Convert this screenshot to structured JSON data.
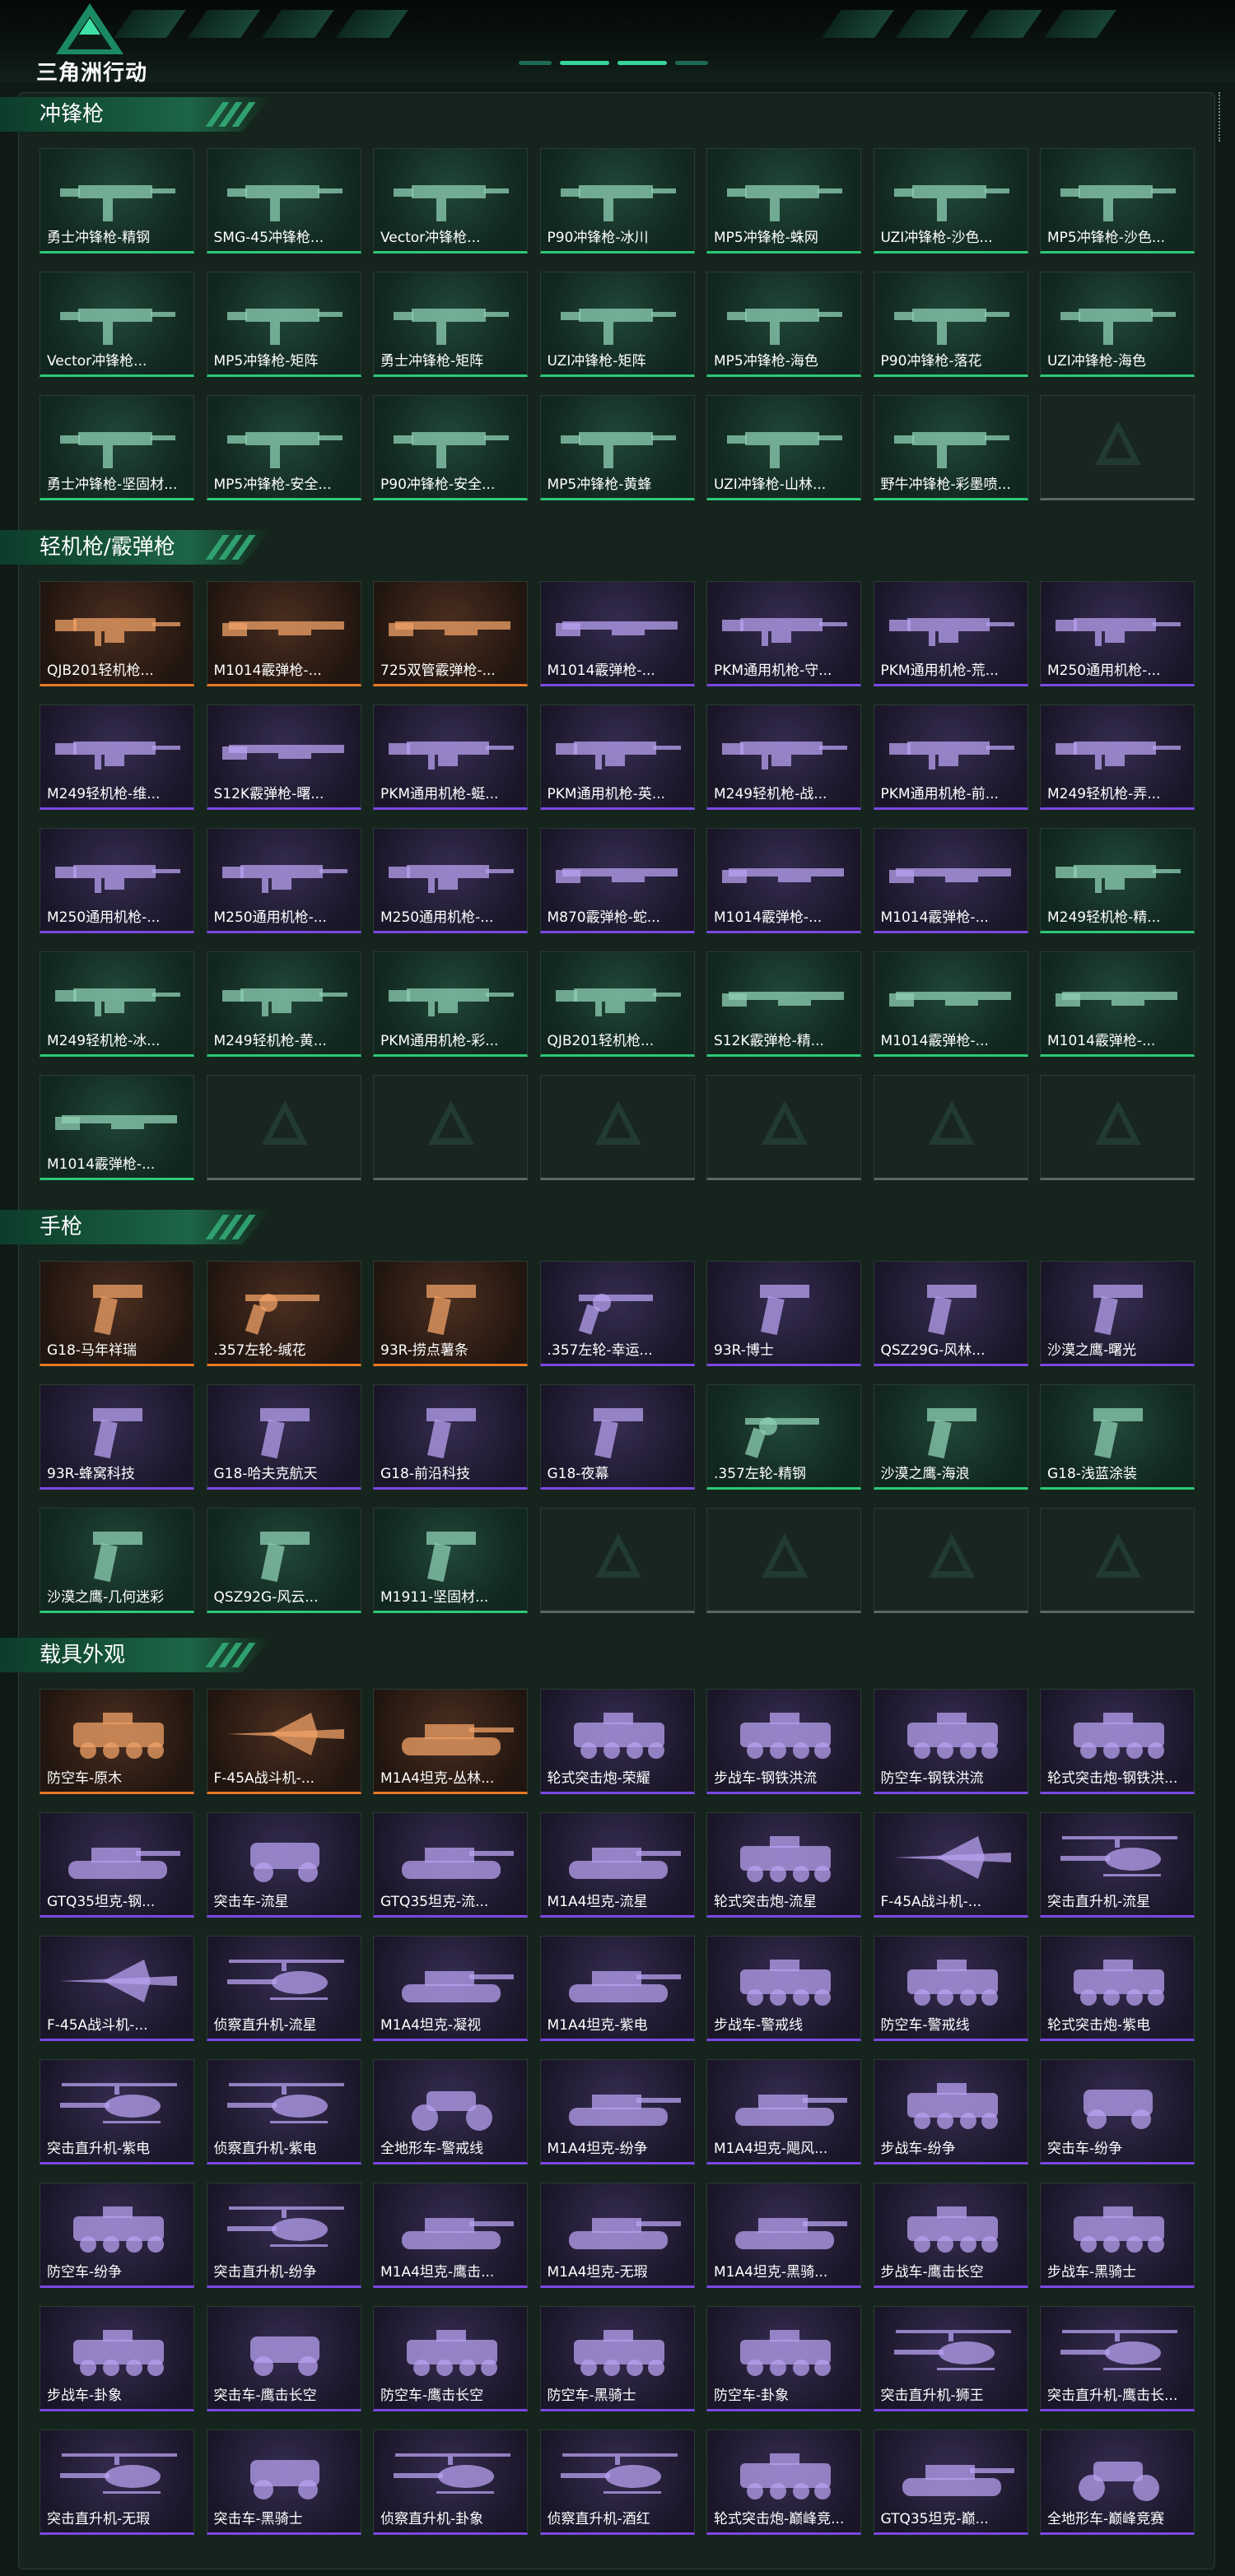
{
  "app": {
    "logo_text": "三角洲行动"
  },
  "colors": {
    "green_rarity": "#2ec878",
    "orange_rarity": "#e97a23",
    "purple_rarity": "#7b48e4",
    "empty_slot": "#5a6763",
    "accent": "#36d39b"
  },
  "sections": [
    {
      "title": "冲锋枪",
      "items": [
        {
          "label": "勇士冲锋枪-精钢",
          "rarity": "green",
          "icon": "smg-icon"
        },
        {
          "label": "SMG-45冲锋枪...",
          "rarity": "green",
          "icon": "smg-icon"
        },
        {
          "label": "Vector冲锋枪...",
          "rarity": "green",
          "icon": "smg-icon"
        },
        {
          "label": "P90冲锋枪-冰川",
          "rarity": "green",
          "icon": "smg-icon"
        },
        {
          "label": "MP5冲锋枪-蛛网",
          "rarity": "green",
          "icon": "smg-icon"
        },
        {
          "label": "UZI冲锋枪-沙色...",
          "rarity": "green",
          "icon": "smg-icon"
        },
        {
          "label": "MP5冲锋枪-沙色...",
          "rarity": "green",
          "icon": "smg-icon"
        },
        {
          "label": "Vector冲锋枪...",
          "rarity": "green",
          "icon": "smg-icon"
        },
        {
          "label": "MP5冲锋枪-矩阵",
          "rarity": "green",
          "icon": "smg-icon"
        },
        {
          "label": "勇士冲锋枪-矩阵",
          "rarity": "green",
          "icon": "smg-icon"
        },
        {
          "label": "UZI冲锋枪-矩阵",
          "rarity": "green",
          "icon": "smg-icon"
        },
        {
          "label": "MP5冲锋枪-海色",
          "rarity": "green",
          "icon": "smg-icon"
        },
        {
          "label": "P90冲锋枪-落花",
          "rarity": "green",
          "icon": "smg-icon"
        },
        {
          "label": "UZI冲锋枪-海色",
          "rarity": "green",
          "icon": "smg-icon"
        },
        {
          "label": "勇士冲锋枪-坚固材...",
          "rarity": "green",
          "icon": "smg-icon"
        },
        {
          "label": "MP5冲锋枪-安全...",
          "rarity": "green",
          "icon": "smg-icon"
        },
        {
          "label": "P90冲锋枪-安全...",
          "rarity": "green",
          "icon": "smg-icon"
        },
        {
          "label": "MP5冲锋枪-黄蜂",
          "rarity": "green",
          "icon": "smg-icon"
        },
        {
          "label": "UZI冲锋枪-山林...",
          "rarity": "green",
          "icon": "smg-icon"
        },
        {
          "label": "野牛冲锋枪-彩墨喷...",
          "rarity": "green",
          "icon": "smg-icon"
        },
        {
          "label": "",
          "rarity": "empty",
          "icon": "delta-logo-icon"
        }
      ]
    },
    {
      "title": "轻机枪/霰弹枪",
      "items": [
        {
          "label": "QJB201轻机枪...",
          "rarity": "orange",
          "icon": "lmg-icon"
        },
        {
          "label": "M1014霰弹枪-...",
          "rarity": "orange",
          "icon": "shotgun-icon"
        },
        {
          "label": "725双管霰弹枪-...",
          "rarity": "orange",
          "icon": "shotgun-icon"
        },
        {
          "label": "M1014霰弹枪-...",
          "rarity": "purple",
          "icon": "shotgun-icon"
        },
        {
          "label": "PKM通用机枪-守...",
          "rarity": "purple",
          "icon": "lmg-icon"
        },
        {
          "label": "PKM通用机枪-荒...",
          "rarity": "purple",
          "icon": "lmg-icon"
        },
        {
          "label": "M250通用机枪-...",
          "rarity": "purple",
          "icon": "lmg-icon"
        },
        {
          "label": "M249轻机枪-维...",
          "rarity": "purple",
          "icon": "lmg-icon"
        },
        {
          "label": "S12K霰弹枪-曙...",
          "rarity": "purple",
          "icon": "shotgun-icon"
        },
        {
          "label": "PKM通用机枪-蜓...",
          "rarity": "purple",
          "icon": "lmg-icon"
        },
        {
          "label": "PKM通用机枪-英...",
          "rarity": "purple",
          "icon": "lmg-icon"
        },
        {
          "label": "M249轻机枪-战...",
          "rarity": "purple",
          "icon": "lmg-icon"
        },
        {
          "label": "PKM通用机枪-前...",
          "rarity": "purple",
          "icon": "lmg-icon"
        },
        {
          "label": "M249轻机枪-弄...",
          "rarity": "purple",
          "icon": "lmg-icon"
        },
        {
          "label": "M250通用机枪-...",
          "rarity": "purple",
          "icon": "lmg-icon"
        },
        {
          "label": "M250通用机枪-...",
          "rarity": "purple",
          "icon": "lmg-icon"
        },
        {
          "label": "M250通用机枪-...",
          "rarity": "purple",
          "icon": "lmg-icon"
        },
        {
          "label": "M870霰弹枪-蛇...",
          "rarity": "purple",
          "icon": "shotgun-icon"
        },
        {
          "label": "M1014霰弹枪-...",
          "rarity": "purple",
          "icon": "shotgun-icon"
        },
        {
          "label": "M1014霰弹枪-...",
          "rarity": "purple",
          "icon": "shotgun-icon"
        },
        {
          "label": "M249轻机枪-精...",
          "rarity": "green",
          "icon": "lmg-icon"
        },
        {
          "label": "M249轻机枪-冰...",
          "rarity": "green",
          "icon": "lmg-icon"
        },
        {
          "label": "M249轻机枪-黄...",
          "rarity": "green",
          "icon": "lmg-icon"
        },
        {
          "label": "PKM通用机枪-彩...",
          "rarity": "green",
          "icon": "lmg-icon"
        },
        {
          "label": "QJB201轻机枪...",
          "rarity": "green",
          "icon": "lmg-icon"
        },
        {
          "label": "S12K霰弹枪-精...",
          "rarity": "green",
          "icon": "shotgun-icon"
        },
        {
          "label": "M1014霰弹枪-...",
          "rarity": "green",
          "icon": "shotgun-icon"
        },
        {
          "label": "M1014霰弹枪-...",
          "rarity": "green",
          "icon": "shotgun-icon"
        },
        {
          "label": "M1014霰弹枪-...",
          "rarity": "green",
          "icon": "shotgun-icon"
        },
        {
          "label": "",
          "rarity": "empty",
          "icon": "delta-logo-icon"
        },
        {
          "label": "",
          "rarity": "empty",
          "icon": "delta-logo-icon"
        },
        {
          "label": "",
          "rarity": "empty",
          "icon": "delta-logo-icon"
        },
        {
          "label": "",
          "rarity": "empty",
          "icon": "delta-logo-icon"
        },
        {
          "label": "",
          "rarity": "empty",
          "icon": "delta-logo-icon"
        },
        {
          "label": "",
          "rarity": "empty",
          "icon": "delta-logo-icon"
        }
      ]
    },
    {
      "title": "手枪",
      "items": [
        {
          "label": "G18-马年祥瑞",
          "rarity": "orange",
          "icon": "pistol-icon"
        },
        {
          "label": ".357左轮-缄花",
          "rarity": "orange",
          "icon": "revolver-icon"
        },
        {
          "label": "93R-捞点薯条",
          "rarity": "orange",
          "icon": "pistol-icon"
        },
        {
          "label": ".357左轮-幸运...",
          "rarity": "purple",
          "icon": "revolver-icon"
        },
        {
          "label": "93R-博士",
          "rarity": "purple",
          "icon": "pistol-icon"
        },
        {
          "label": "QSZ29G-风林...",
          "rarity": "purple",
          "icon": "pistol-icon"
        },
        {
          "label": "沙漠之鹰-曙光",
          "rarity": "purple",
          "icon": "pistol-icon"
        },
        {
          "label": "93R-蜂窝科技",
          "rarity": "purple",
          "icon": "pistol-icon"
        },
        {
          "label": "G18-哈夫克航天",
          "rarity": "purple",
          "icon": "pistol-icon"
        },
        {
          "label": "G18-前沿科技",
          "rarity": "purple",
          "icon": "pistol-icon"
        },
        {
          "label": "G18-夜幕",
          "rarity": "purple",
          "icon": "pistol-icon"
        },
        {
          "label": ".357左轮-精钢",
          "rarity": "green",
          "icon": "revolver-icon"
        },
        {
          "label": "沙漠之鹰-海浪",
          "rarity": "green",
          "icon": "pistol-icon"
        },
        {
          "label": "G18-浅蓝涂装",
          "rarity": "green",
          "icon": "pistol-icon"
        },
        {
          "label": "沙漠之鹰-几何迷彩",
          "rarity": "green",
          "icon": "pistol-icon"
        },
        {
          "label": "QSZ92G-风云...",
          "rarity": "green",
          "icon": "pistol-icon"
        },
        {
          "label": "M1911-坚固材...",
          "rarity": "green",
          "icon": "pistol-icon"
        },
        {
          "label": "",
          "rarity": "empty",
          "icon": "delta-logo-icon"
        },
        {
          "label": "",
          "rarity": "empty",
          "icon": "delta-logo-icon"
        },
        {
          "label": "",
          "rarity": "empty",
          "icon": "delta-logo-icon"
        },
        {
          "label": "",
          "rarity": "empty",
          "icon": "delta-logo-icon"
        }
      ]
    },
    {
      "title": "载具外观",
      "items": [
        {
          "label": "防空车-原木",
          "rarity": "orange",
          "icon": "armored-car-icon"
        },
        {
          "label": "F-45A战斗机-...",
          "rarity": "orange",
          "icon": "jet-icon"
        },
        {
          "label": "M1A4坦克-丛林...",
          "rarity": "orange",
          "icon": "tank-icon"
        },
        {
          "label": "轮式突击炮-荣耀",
          "rarity": "purple",
          "icon": "armored-car-icon"
        },
        {
          "label": "步战车-钢铁洪流",
          "rarity": "purple",
          "icon": "armored-car-icon"
        },
        {
          "label": "防空车-钢铁洪流",
          "rarity": "purple",
          "icon": "armored-car-icon"
        },
        {
          "label": "轮式突击炮-钢铁洪...",
          "rarity": "purple",
          "icon": "armored-car-icon"
        },
        {
          "label": "GTQ35坦克-钢...",
          "rarity": "purple",
          "icon": "tank-icon"
        },
        {
          "label": "突击车-流星",
          "rarity": "purple",
          "icon": "buggy-icon"
        },
        {
          "label": "GTQ35坦克-流...",
          "rarity": "purple",
          "icon": "tank-icon"
        },
        {
          "label": "M1A4坦克-流星",
          "rarity": "purple",
          "icon": "tank-icon"
        },
        {
          "label": "轮式突击炮-流星",
          "rarity": "purple",
          "icon": "armored-car-icon"
        },
        {
          "label": "F-45A战斗机-...",
          "rarity": "purple",
          "icon": "jet-icon"
        },
        {
          "label": "突击直升机-流星",
          "rarity": "purple",
          "icon": "helicopter-icon"
        },
        {
          "label": "F-45A战斗机-...",
          "rarity": "purple",
          "icon": "jet-icon"
        },
        {
          "label": "侦察直升机-流星",
          "rarity": "purple",
          "icon": "helicopter-icon"
        },
        {
          "label": "M1A4坦克-凝视",
          "rarity": "purple",
          "icon": "tank-icon"
        },
        {
          "label": "M1A4坦克-紫电",
          "rarity": "purple",
          "icon": "tank-icon"
        },
        {
          "label": "步战车-警戒线",
          "rarity": "purple",
          "icon": "armored-car-icon"
        },
        {
          "label": "防空车-警戒线",
          "rarity": "purple",
          "icon": "armored-car-icon"
        },
        {
          "label": "轮式突击炮-紫电",
          "rarity": "purple",
          "icon": "armored-car-icon"
        },
        {
          "label": "突击直升机-紫电",
          "rarity": "purple",
          "icon": "helicopter-icon"
        },
        {
          "label": "侦察直升机-紫电",
          "rarity": "purple",
          "icon": "helicopter-icon"
        },
        {
          "label": "全地形车-警戒线",
          "rarity": "purple",
          "icon": "atv-icon"
        },
        {
          "label": "M1A4坦克-纷争",
          "rarity": "purple",
          "icon": "tank-icon"
        },
        {
          "label": "M1A4坦克-飓风...",
          "rarity": "purple",
          "icon": "tank-icon"
        },
        {
          "label": "步战车-纷争",
          "rarity": "purple",
          "icon": "armored-car-icon"
        },
        {
          "label": "突击车-纷争",
          "rarity": "purple",
          "icon": "buggy-icon"
        },
        {
          "label": "防空车-纷争",
          "rarity": "purple",
          "icon": "armored-car-icon"
        },
        {
          "label": "突击直升机-纷争",
          "rarity": "purple",
          "icon": "helicopter-icon"
        },
        {
          "label": "M1A4坦克-鹰击...",
          "rarity": "purple",
          "icon": "tank-icon"
        },
        {
          "label": "M1A4坦克-无瑕",
          "rarity": "purple",
          "icon": "tank-icon"
        },
        {
          "label": "M1A4坦克-黑骑...",
          "rarity": "purple",
          "icon": "tank-icon"
        },
        {
          "label": "步战车-鹰击长空",
          "rarity": "purple",
          "icon": "armored-car-icon"
        },
        {
          "label": "步战车-黑骑士",
          "rarity": "purple",
          "icon": "armored-car-icon"
        },
        {
          "label": "步战车-卦象",
          "rarity": "purple",
          "icon": "armored-car-icon"
        },
        {
          "label": "突击车-鹰击长空",
          "rarity": "purple",
          "icon": "buggy-icon"
        },
        {
          "label": "防空车-鹰击长空",
          "rarity": "purple",
          "icon": "armored-car-icon"
        },
        {
          "label": "防空车-黑骑士",
          "rarity": "purple",
          "icon": "armored-car-icon"
        },
        {
          "label": "防空车-卦象",
          "rarity": "purple",
          "icon": "armored-car-icon"
        },
        {
          "label": "突击直升机-狮王",
          "rarity": "purple",
          "icon": "helicopter-icon"
        },
        {
          "label": "突击直升机-鹰击长...",
          "rarity": "purple",
          "icon": "helicopter-icon"
        },
        {
          "label": "突击直升机-无瑕",
          "rarity": "purple",
          "icon": "helicopter-icon"
        },
        {
          "label": "突击车-黑骑士",
          "rarity": "purple",
          "icon": "buggy-icon"
        },
        {
          "label": "侦察直升机-卦象",
          "rarity": "purple",
          "icon": "helicopter-icon"
        },
        {
          "label": "侦察直升机-酒红",
          "rarity": "purple",
          "icon": "helicopter-icon"
        },
        {
          "label": "轮式突击炮-巅峰竞...",
          "rarity": "purple",
          "icon": "armored-car-icon"
        },
        {
          "label": "GTQ35坦克-巅...",
          "rarity": "purple",
          "icon": "tank-icon"
        },
        {
          "label": "全地形车-巅峰竞赛",
          "rarity": "purple",
          "icon": "atv-icon"
        }
      ]
    }
  ]
}
